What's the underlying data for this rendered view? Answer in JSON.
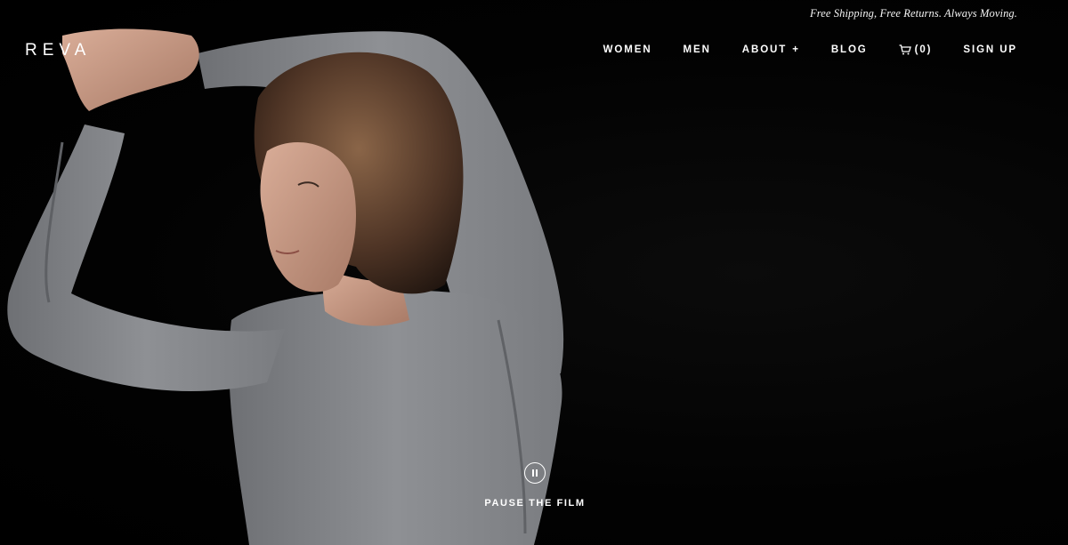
{
  "header": {
    "promo_text": "Free Shipping, Free Returns. Always Moving.",
    "logo_text": "REVA"
  },
  "nav": {
    "women_label": "WOMEN",
    "men_label": "MEN",
    "about_label": "ABOUT",
    "about_plus": "+",
    "blog_label": "BLOG",
    "cart_label": "(0)",
    "cart_icon": "cart-icon",
    "signup_label": "SIGN UP"
  },
  "hero": {
    "pause_icon": "pause-icon",
    "pause_label": "PAUSE THE FILM",
    "photo_subject": "woman-in-grey-long-sleeve-stretching"
  },
  "colors": {
    "background": "#000000",
    "text": "#ffffff",
    "shirt": "#8a8c90",
    "skin": "#c79a85",
    "hair": "#5b3e2c"
  }
}
